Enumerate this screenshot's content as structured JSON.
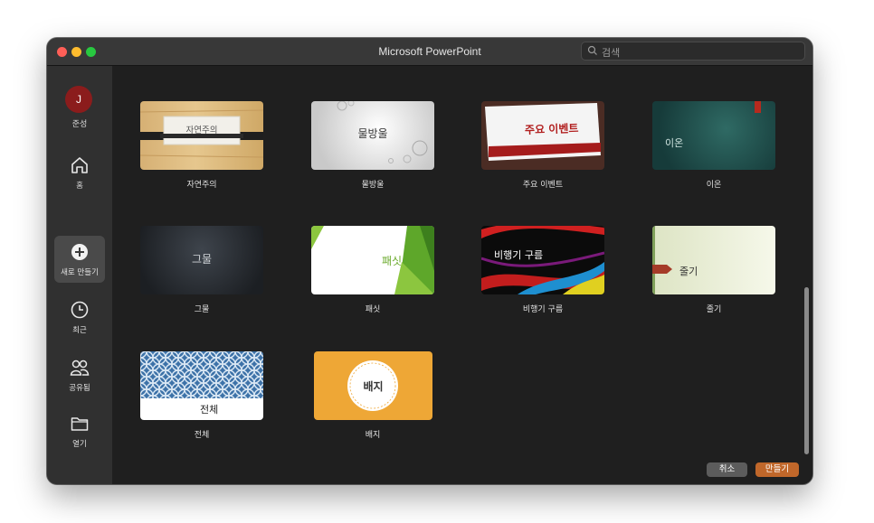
{
  "window": {
    "title": "Microsoft PowerPoint"
  },
  "search": {
    "placeholder": "검색",
    "icon": "search-icon"
  },
  "sidebar": {
    "avatar_initial": "J",
    "user_name": "준성",
    "items": [
      {
        "label": "홈",
        "icon": "home-icon"
      },
      {
        "label": "새로 만들기",
        "icon": "plus-circle-icon",
        "selected": true
      },
      {
        "label": "최근",
        "icon": "clock-icon"
      },
      {
        "label": "공유됨",
        "icon": "people-icon"
      },
      {
        "label": "열기",
        "icon": "folder-icon"
      }
    ]
  },
  "templates": [
    {
      "name": "자연주의",
      "thumb_text": "자연주의"
    },
    {
      "name": "물방울",
      "thumb_text": "물방울"
    },
    {
      "name": "주요 이벤트",
      "thumb_text": "주요 이벤트"
    },
    {
      "name": "이온",
      "thumb_text": "이온"
    },
    {
      "name": "그물",
      "thumb_text": "그물"
    },
    {
      "name": "패싯",
      "thumb_text": "패싯"
    },
    {
      "name": "비행기 구름",
      "thumb_text": "비행기 구름"
    },
    {
      "name": "줄기",
      "thumb_text": "줄기"
    },
    {
      "name": "전체",
      "thumb_text": "전체"
    },
    {
      "name": "배지",
      "thumb_text": "배지"
    }
  ],
  "buttons": {
    "cancel": "취소",
    "create": "만들기"
  },
  "colors": {
    "accent": "#c0672a",
    "avatar": "#8b1c1c",
    "selected_nav": "#4a4a4a"
  }
}
